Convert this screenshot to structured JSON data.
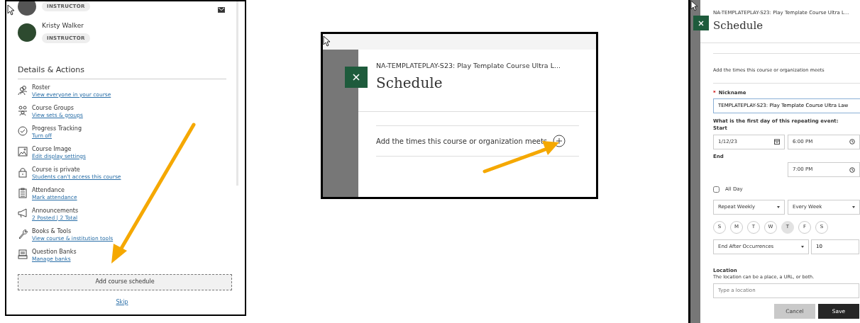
{
  "roster_panel": {
    "members": [
      {
        "role": "INSTRUCTOR"
      },
      {
        "name": "Kristy Walker",
        "role": "INSTRUCTOR"
      }
    ],
    "section_title": "Details & Actions",
    "actions": [
      {
        "title": "Roster",
        "link": "View everyone in your course"
      },
      {
        "title": "Course Groups",
        "link": "View sets & groups"
      },
      {
        "title": "Progress Tracking",
        "link": "Turn off"
      },
      {
        "title": "Course Image",
        "link": "Edit display settings"
      },
      {
        "title": "Course is private",
        "link": "Students can't access this course"
      },
      {
        "title": "Attendance",
        "link": "Mark attendance"
      },
      {
        "title": "Announcements",
        "link": "2 Posted | 2 Total"
      },
      {
        "title": "Books & Tools",
        "link": "View course & institution tools"
      },
      {
        "title": "Question Banks",
        "link": "Manage banks"
      }
    ],
    "button": "Add course schedule",
    "skip": "Skip"
  },
  "schedule_panel": {
    "course": "NA-TEMPLATEPLAY-S23: Play Template Course Ultra L...",
    "title": "Schedule",
    "prompt": "Add the times this course or organization meets"
  },
  "schedule_form": {
    "course": "NA-TEMPLATEPLAY-S23: Play Template Course Ultra L...",
    "title": "Schedule",
    "prompt": "Add the times this course or organization meets",
    "required_marker": "*",
    "nickname_label": "Nickname",
    "nickname_value": "TEMPLATEPLAY-S23: Play Template Course Ultra Law",
    "first_day_label": "What is the first day of this repeating event:",
    "start_label": "Start",
    "start_date": "1/12/23",
    "start_time": "6:00 PM",
    "end_label": "End",
    "end_time": "7:00 PM",
    "all_day": {
      "label": "All Day",
      "checked": false
    },
    "repeat": "Repeat Weekly",
    "frequency": "Every Week",
    "days": [
      {
        "label": "S",
        "selected": false
      },
      {
        "label": "M",
        "selected": false
      },
      {
        "label": "T",
        "selected": false
      },
      {
        "label": "W",
        "selected": false
      },
      {
        "label": "T",
        "selected": true
      },
      {
        "label": "F",
        "selected": false
      },
      {
        "label": "S",
        "selected": false
      }
    ],
    "end_rule": "End After Occurrences",
    "occurrences": "10",
    "location_label": "Location",
    "location_help": "The location can be a place, a URL, or both.",
    "location_placeholder": "Type a location",
    "buttons": [
      {
        "label": "Cancel",
        "kind": "secondary"
      },
      {
        "label": "Save",
        "kind": "primary"
      }
    ]
  }
}
